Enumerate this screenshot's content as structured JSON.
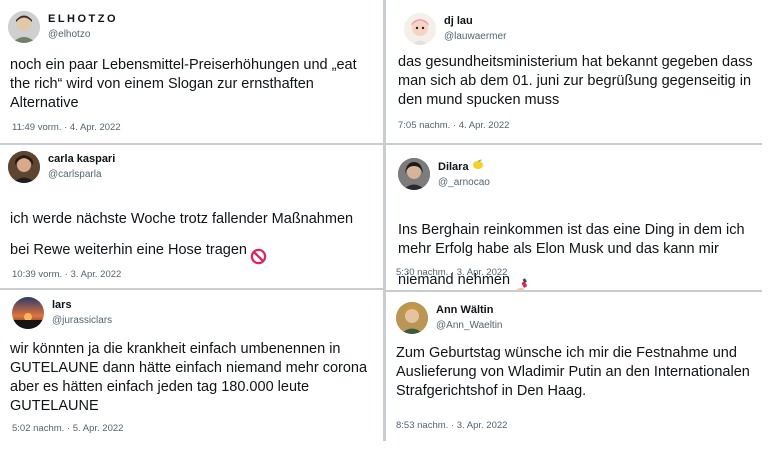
{
  "colors": {
    "text": "#0f1419",
    "secondary": "#536471",
    "divider": "#c9ccd0"
  },
  "tweets": [
    {
      "display_name": "ELHOTZO",
      "handle": "@elhotzo",
      "text": "noch ein paar Lebensmittel-Preiserhöhungen und „eat\nthe rich“ wird von einem Slogan zur ernsthaften\nAlternative",
      "timestamp": "11:49 vorm. · 4. Apr. 2022",
      "avatar_icon": "avatar-photo"
    },
    {
      "display_name": "dj lau",
      "handle": "@lauwaermer",
      "text": "das gesundheitsministerium hat bekannt gegeben dass\nman sich ab dem 01. juni zur begrüßung gegenseitig in\nden mund spucken muss",
      "timestamp": "7:05 nachm. · 4. Apr. 2022",
      "avatar_icon": "avatar-cartoon"
    },
    {
      "display_name": "carla kaspari",
      "handle": "@carlsparla",
      "text": "ich werde nächste Woche trotz fallender Maßnahmen\nbei Rewe weiterhin eine Hose tragen",
      "timestamp": "10:39 vorm. · 3. Apr. 2022",
      "avatar_icon": "avatar-photo",
      "text_emoji": "prohibited-icon"
    },
    {
      "display_name": "Dilara",
      "handle": "@_arnocao",
      "text": "Ins Berghain reinkommen ist das eine Ding in dem ich\nmehr Erfolg habe als Elon Musk und das kann mir\nniemand nehmen",
      "timestamp": "5:30 nachm. · 3. Apr. 2022",
      "avatar_icon": "avatar-photo",
      "name_emoji": "lemon-icon",
      "text_emoji": "nail-polish-icon"
    },
    {
      "display_name": "lars",
      "handle": "@jurassiclars",
      "text": "wir könnten ja die krankheit einfach umbenennen in\nGUTELAUNE dann hätte einfach niemand mehr corona\naber es hätten einfach jeden tag 180.000 leute\nGUTELAUNE",
      "timestamp": "5:02 nachm. · 5. Apr. 2022",
      "avatar_icon": "avatar-sunset"
    },
    {
      "display_name": "Ann Wältin",
      "handle": "@Ann_Waeltin",
      "text": "Zum Geburtstag wünsche ich mir die Festnahme und\nAuslieferung von Wladimir Putin an den Internationalen\nStrafgerichtshof in Den Haag.",
      "timestamp": "8:53 nachm. · 3. Apr. 2022",
      "avatar_icon": "avatar-photo"
    }
  ]
}
